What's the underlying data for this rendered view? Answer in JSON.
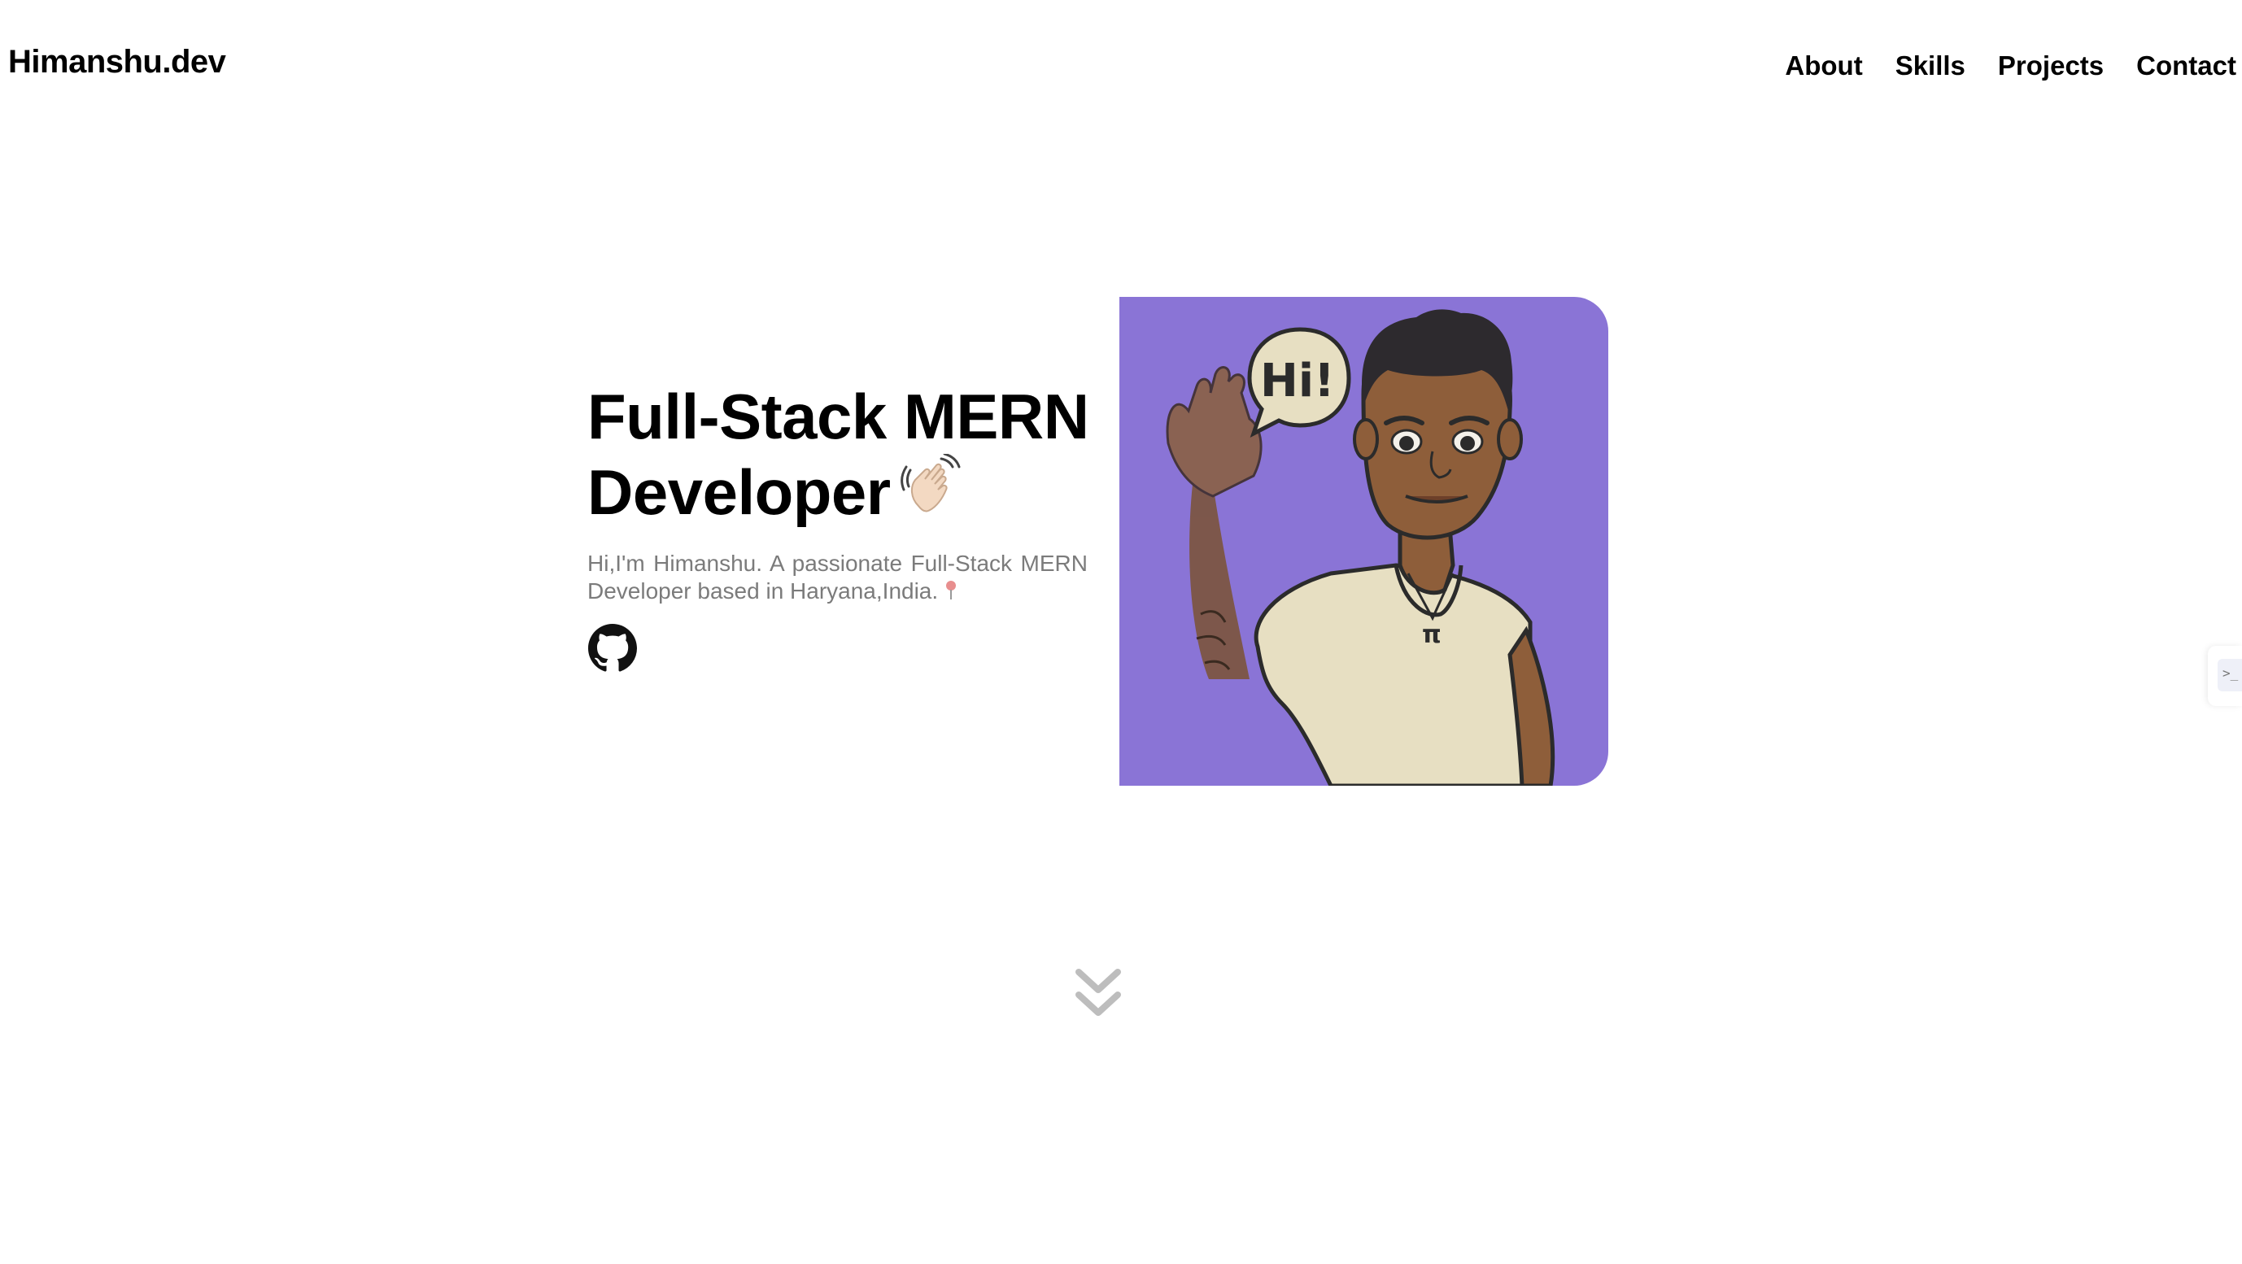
{
  "header": {
    "brand": "Himanshu.dev",
    "nav": [
      "About",
      "Skills",
      "Projects",
      "Contact"
    ]
  },
  "hero": {
    "title_line1": "Full-Stack MERN",
    "title_line2": "Developer",
    "wave_icon": "waving-hand-emoji",
    "description": "Hi,I'm Himanshu. A passionate Full-Stack MERN Developer based in Haryana,India.",
    "pin_icon": "round-pushpin-emoji",
    "social": [
      {
        "name": "github-icon"
      }
    ]
  },
  "avatar": {
    "speech_bubble_text": "Hi!",
    "background_color": "#8a74d6",
    "shirt_color": "#e7dfc2",
    "skin_color": "#8e5e3a"
  },
  "scroll_indicator": {
    "icon": "chevrons-down-icon",
    "color": "#bdbdbd"
  },
  "side_widget": {
    "icon_text": ">_"
  }
}
